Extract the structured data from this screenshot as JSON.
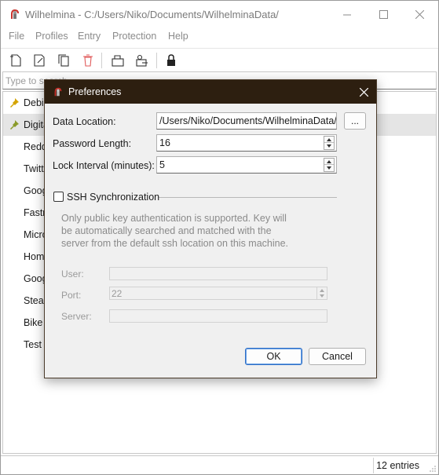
{
  "window": {
    "title": "Wilhelmina - C:/Users/Niko/Documents/WilhelminaData/"
  },
  "menu": [
    "File",
    "Profiles",
    "Entry",
    "Protection",
    "Help"
  ],
  "toolbar": {
    "icons": [
      "new-entry-icon",
      "edit-entry-icon",
      "duplicate-entry-icon",
      "delete-entry-icon",
      "copy-username-icon",
      "copy-password-icon",
      "lock-icon"
    ]
  },
  "search": {
    "placeholder": "Type to search"
  },
  "entries": [
    {
      "label": "Debia",
      "pinned": true,
      "selected": false
    },
    {
      "label": "Digita",
      "pinned": true,
      "selected": true
    },
    {
      "label": "Reddi",
      "pinned": false,
      "selected": false
    },
    {
      "label": "Twitte",
      "pinned": false,
      "selected": false
    },
    {
      "label": "Goog",
      "pinned": false,
      "selected": false
    },
    {
      "label": "Fastn",
      "pinned": false,
      "selected": false
    },
    {
      "label": "Micro",
      "pinned": false,
      "selected": false
    },
    {
      "label": "Hom",
      "pinned": false,
      "selected": false
    },
    {
      "label": "Goog",
      "pinned": false,
      "selected": false
    },
    {
      "label": "Stear",
      "pinned": false,
      "selected": false
    },
    {
      "label": "Bike l",
      "pinned": false,
      "selected": false
    },
    {
      "label": "Test e",
      "pinned": false,
      "selected": false
    }
  ],
  "status": {
    "count_text": "12 entries"
  },
  "dialog": {
    "title": "Preferences",
    "data_location_label": "Data Location:",
    "data_location_value": "/Users/Niko/Documents/WilhelminaData/",
    "browse_label": "...",
    "password_length_label": "Password Length:",
    "password_length_value": "16",
    "lock_interval_label": "Lock Interval (minutes):",
    "lock_interval_value": "5",
    "ssh_label": "SSH Synchronization",
    "ssh_checked": false,
    "ssh_info": "Only public key authentication is supported. Key will be automatically searched and matched with the server from the default ssh location on this machine.",
    "user_label": "User:",
    "user_value": "",
    "port_label": "Port:",
    "port_value": "22",
    "server_label": "Server:",
    "server_value": "",
    "ok_label": "OK",
    "cancel_label": "Cancel"
  },
  "colors": {
    "dialog_titlebar": "#2d1f10",
    "selection": "#e5e5e5",
    "delete_icon": "#e05a5a",
    "pin": "#d4a400",
    "app_icon_red": "#c8312b"
  }
}
